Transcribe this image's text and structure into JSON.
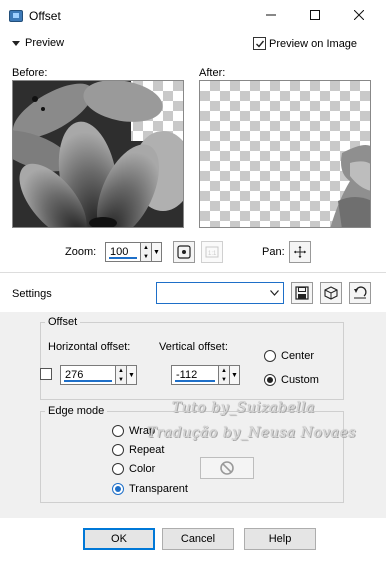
{
  "window": {
    "title": "Offset",
    "icon": "app-icon",
    "minimize_icon": "minimize-icon",
    "maximize_icon": "maximize-icon",
    "close_icon": "close-icon"
  },
  "preview": {
    "toggle_label": "Preview",
    "preview_on_image_label": "Preview on Image",
    "preview_on_image_checked": true,
    "before_label": "Before:",
    "after_label": "After:"
  },
  "zoom": {
    "label": "Zoom:",
    "value": "100",
    "pan_label": "Pan:"
  },
  "settings": {
    "label": "Settings",
    "preset_value": ""
  },
  "offset": {
    "legend": "Offset",
    "horizontal_label": "Horizontal offset:",
    "horizontal_value": "276",
    "vertical_label": "Vertical offset:",
    "vertical_value": "-112",
    "center_label": "Center",
    "custom_label": "Custom",
    "selected": "Custom"
  },
  "edge_mode": {
    "legend": "Edge mode",
    "options": [
      "Wrap",
      "Repeat",
      "Color",
      "Transparent"
    ],
    "selected": "Transparent"
  },
  "watermark": {
    "line1": "Tuto by_Suizabella",
    "line2": "Tradução by_Neusa Novaes"
  },
  "buttons": {
    "ok": "OK",
    "cancel": "Cancel",
    "help": "Help"
  },
  "colors": {
    "accent": "#1e6fc8",
    "section_bg": "#f0f0f0",
    "checker": "#c9c9c9"
  }
}
